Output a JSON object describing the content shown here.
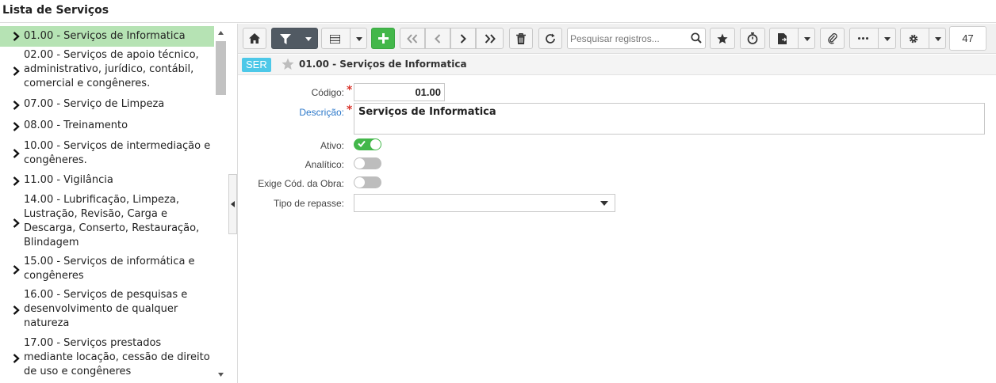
{
  "window": {
    "title": "Lista de Serviços"
  },
  "tree": {
    "items": [
      {
        "label": "01.00 - Serviços de Informatica",
        "selected": true
      },
      {
        "label": "02.00 - Serviços de apoio técnico, administrativo, jurídico, contábil, comercial e congêneres."
      },
      {
        "label": "07.00 - Serviço de Limpeza"
      },
      {
        "label": "08.00 - Treinamento"
      },
      {
        "label": "10.00 - Serviços de intermediação e congêneres."
      },
      {
        "label": "11.00 - Vigilância"
      },
      {
        "label": "14.00 - Lubrificação, Limpeza, Lustração, Revisão, Carga e Descarga, Conserto, Restauração, Blindagem"
      },
      {
        "label": "15.00 - Serviços de informática e congêneres"
      },
      {
        "label": "16.00 - Serviços de pesquisas e desenvolvimento de qualquer natureza"
      },
      {
        "label": "17.00 - Serviços prestados mediante locação, cessão de direito de uso e congêneres"
      }
    ]
  },
  "toolbar": {
    "search_placeholder": "Pesquisar registros...",
    "record_count": "47",
    "icons": [
      "home-icon",
      "filter-icon",
      "list-view-icon",
      "add-icon",
      "first-page-icon",
      "previous-icon",
      "next-icon",
      "last-page-icon",
      "delete-icon",
      "refresh-icon",
      "search-icon",
      "favorite-icon",
      "timer-icon",
      "report-icon",
      "attachment-icon",
      "more-icon",
      "settings-icon"
    ]
  },
  "record": {
    "badge": "SER",
    "title": "01.00 - Serviços de Informatica"
  },
  "form": {
    "codigo_label": "Código:",
    "codigo_value": "01.00",
    "descricao_label": "Descrição:",
    "descricao_value": "Serviços de Informatica",
    "ativo_label": "Ativo:",
    "ativo": true,
    "analitico_label": "Analítico:",
    "analitico": false,
    "exige_label": "Exige Cód. da Obra:",
    "exige": false,
    "tipo_repasse_label": "Tipo de repasse:",
    "tipo_repasse_value": ""
  },
  "colors": {
    "selected_row": "#b6e3b4",
    "badge": "#4dc8e8",
    "toggle_on": "#43b74a",
    "add_button": "#43b74a",
    "required": "#d9342b",
    "link_label": "#2a77c9"
  }
}
